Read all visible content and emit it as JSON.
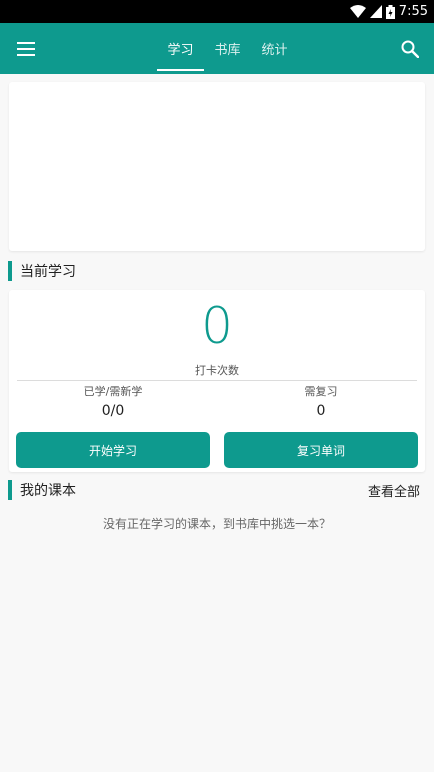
{
  "status_bar": {
    "time": "7:55"
  },
  "appbar": {
    "tabs": [
      {
        "label": "学习",
        "active": true
      },
      {
        "label": "书库",
        "active": false
      },
      {
        "label": "统计",
        "active": false
      }
    ],
    "accent_color": "#0e9a8e"
  },
  "current_study": {
    "title": "当前学习",
    "checkin_count": "0",
    "checkin_label": "打卡次数",
    "learned_label": "已学/需新学",
    "learned_value": "0/0",
    "review_label": "需复习",
    "review_value": "0",
    "start_button": "开始学习",
    "review_button": "复习单词"
  },
  "my_courses": {
    "title": "我的课本",
    "view_all": "查看全部",
    "empty_message": "没有正在学习的课本，到书库中挑选一本？"
  }
}
